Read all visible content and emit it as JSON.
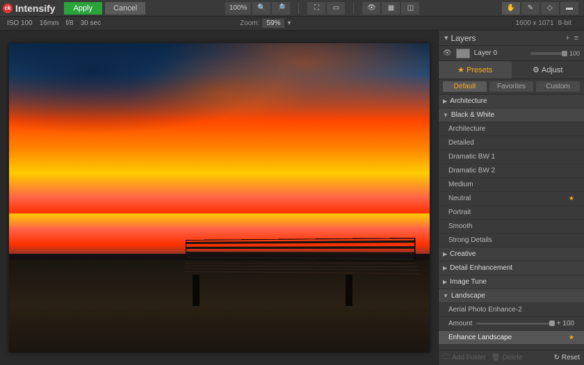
{
  "app": {
    "name": "Intensify"
  },
  "toolbar": {
    "apply": "Apply",
    "cancel": "Cancel",
    "zoom_percent": "100%"
  },
  "infobar": {
    "iso": "ISO 100",
    "focal": "16mm",
    "aperture": "f/8",
    "shutter": "30 sec",
    "zoom_label": "Zoom:",
    "zoom_value": "59%",
    "dimensions": "1600 x 1071",
    "bit_depth": "8-bit"
  },
  "layers": {
    "title": "Layers",
    "layer0": {
      "name": "Layer 0",
      "opacity": 100
    }
  },
  "tabs": {
    "presets": "Presets",
    "adjust": "Adjust"
  },
  "subtabs": {
    "default": "Default",
    "favorites": "Favorites",
    "custom": "Custom"
  },
  "categories": {
    "architecture": "Architecture",
    "bw": "Black & White",
    "creative": "Creative",
    "detail": "Detail Enhancement",
    "tune": "Image Tune",
    "landscape": "Landscape"
  },
  "bw_presets": [
    "Architecture",
    "Detailed",
    "Dramatic BW 1",
    "Dramatic BW 2",
    "Medium",
    "Neutral",
    "Portrait",
    "Smooth",
    "Strong Details"
  ],
  "landscape_presets": {
    "aerial": "Aerial Photo Enhance-2",
    "amount_label": "Amount",
    "amount_value": "+ 100",
    "enhance": "Enhance Landscape"
  },
  "footer": {
    "add_folder": "Add Folder",
    "delete": "Delete",
    "reset": "Reset"
  }
}
